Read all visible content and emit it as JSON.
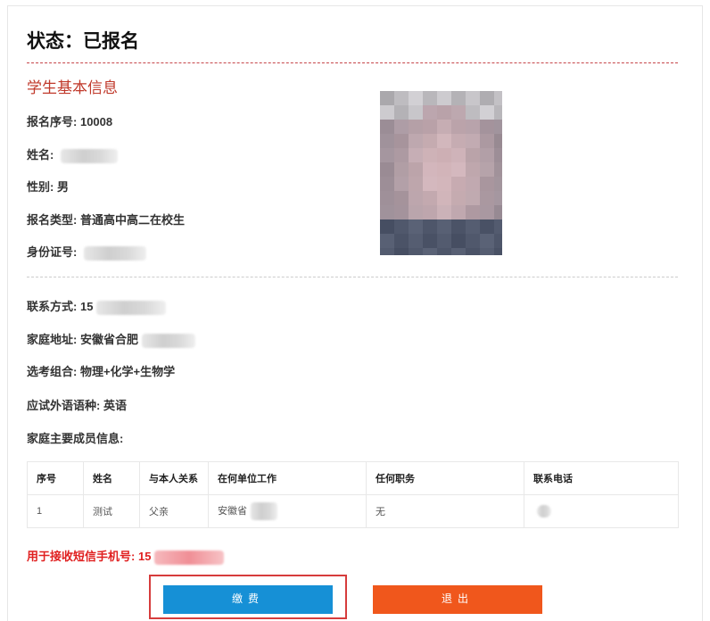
{
  "status": {
    "text": "状态：已报名"
  },
  "student": {
    "section_title": "学生基本信息",
    "reg_no": {
      "label": "报名序号:",
      "value": "10008"
    },
    "name": {
      "label": "姓名:"
    },
    "gender": {
      "label": "性别:",
      "value": "男"
    },
    "reg_type": {
      "label": "报名类型:",
      "value": "普通高中高二在校生"
    },
    "id_card": {
      "label": "身份证号:"
    }
  },
  "contact": {
    "phone": {
      "label": "联系方式:",
      "value": "15"
    },
    "address": {
      "label": "家庭地址:",
      "value": "安徽省合肥"
    },
    "subjects": {
      "label": "选考组合:",
      "value": "物理+化学+生物学"
    },
    "language": {
      "label": "应试外语语种:",
      "value": "英语"
    },
    "family_title": "家庭主要成员信息:"
  },
  "family_table": {
    "headers": [
      "序号",
      "姓名",
      "与本人关系",
      "在何单位工作",
      "任何职务",
      "联系电话"
    ],
    "rows": [
      [
        "1",
        "测试",
        "父亲",
        "安徽省",
        "无",
        ""
      ]
    ]
  },
  "sms": {
    "label": "用于接收短信手机号:",
    "value": "15"
  },
  "buttons": {
    "pay": "缴费",
    "exit": "退出"
  },
  "colors": {
    "accent_red": "#c0392b",
    "pay_blue": "#1690d6",
    "exit_orange": "#f0571c"
  }
}
